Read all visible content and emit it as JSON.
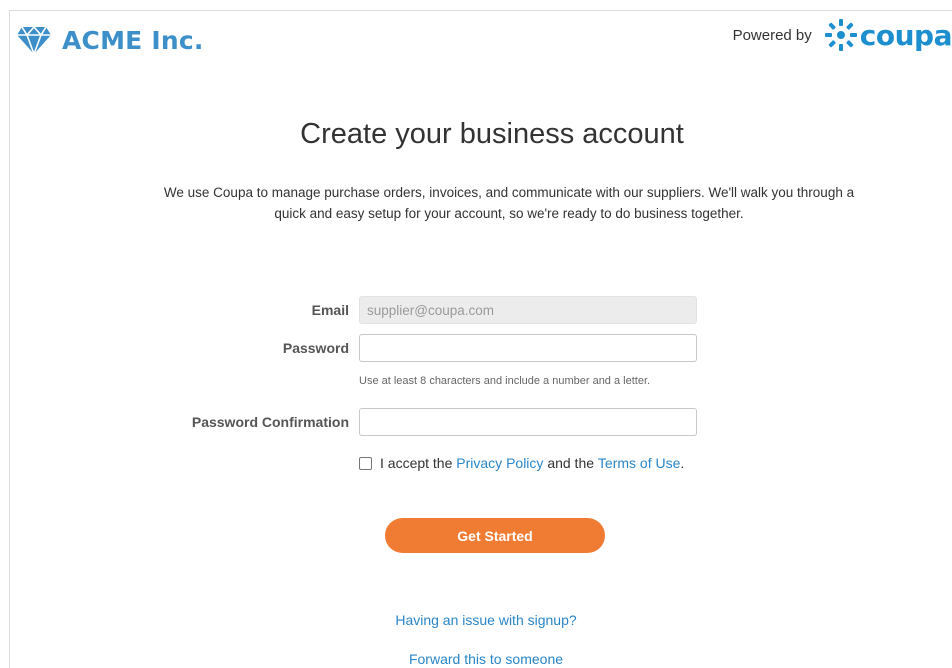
{
  "brand": {
    "name": "ACME Inc.",
    "color": "#3d8fc9"
  },
  "powered_by": {
    "label": "Powered by",
    "logo_text": "coupa",
    "color": "#1d8fcf"
  },
  "page": {
    "title": "Create your business account",
    "intro": "We use Coupa to manage purchase orders, invoices, and communicate with our suppliers. We'll walk you through a quick and easy setup for your account, so we're ready to do business together."
  },
  "form": {
    "email": {
      "label": "Email",
      "value": "supplier@coupa.com"
    },
    "password": {
      "label": "Password",
      "value": "",
      "hint": "Use at least 8 characters and include a number and a letter."
    },
    "password_confirmation": {
      "label": "Password Confirmation",
      "value": ""
    },
    "accept": {
      "prefix": "I accept the",
      "privacy_link": "Privacy Policy",
      "middle": "and the",
      "terms_link": "Terms of Use",
      "suffix": ".",
      "checked": false
    },
    "submit_label": "Get Started"
  },
  "links": {
    "signup_issue": "Having an issue with signup?",
    "forward": "Forward this to someone"
  },
  "colors": {
    "accent_orange": "#f07b32",
    "link_blue": "#2a86c8"
  },
  "icons": {
    "brand_logo": "diamond-icon",
    "coupa_logo": "coupa-sunburst-icon",
    "checkbox": "checkbox-unchecked"
  }
}
